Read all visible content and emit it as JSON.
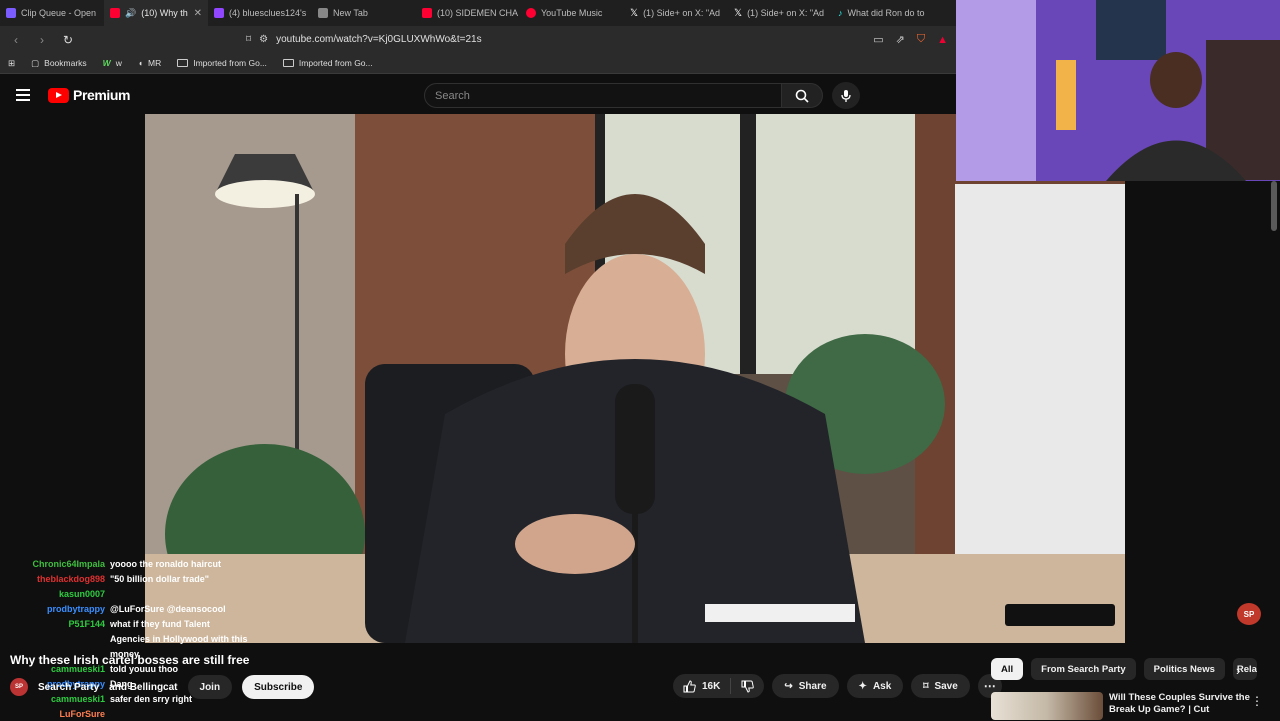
{
  "browser": {
    "tabs": [
      {
        "title": "Clip Queue - Open",
        "color": "#7b5cff"
      },
      {
        "title": "(10) Why th",
        "color": "#ff0033"
      },
      {
        "title": "(4) bluesclues124's",
        "color": "#9146ff"
      },
      {
        "title": "New Tab",
        "color": "#888888"
      },
      {
        "title": "(10) SIDEMEN CHA",
        "color": "#ff0033"
      },
      {
        "title": "YouTube Music",
        "color": "#ff0033"
      },
      {
        "title": "(1) Side+ on X: \"Ad",
        "color": "#ffffff"
      },
      {
        "title": "(1) Side+ on X: \"Ad",
        "color": "#ffffff"
      },
      {
        "title": "What did Ron do to",
        "color": "#25f4ee"
      }
    ],
    "url": "youtube.com/watch?v=Kj0GLUXWhWo&t=21s",
    "bookmarks": [
      {
        "label": "Bookmarks",
        "icon": "bookmarks-icon"
      },
      {
        "label": "w",
        "icon": "w-icon"
      },
      {
        "label": "MR",
        "icon": "mr-icon"
      },
      {
        "label": "Imported from Go...",
        "icon": "folder-icon"
      },
      {
        "label": "Imported from Go...",
        "icon": "folder-icon"
      }
    ]
  },
  "youtube": {
    "logo_text": "Premium",
    "search_placeholder": "Search",
    "video_title": "Why these Irish cartel bosses are still free",
    "channel": "Search Party",
    "channel_extra": "and Bellingcat",
    "avatar_text": "SP",
    "join_label": "Join",
    "subscribe_label": "Subscribe",
    "likes": "16K",
    "share_label": "Share",
    "ask_label": "Ask",
    "save_label": "Save",
    "chips": [
      "All",
      "From Search Party",
      "Politics News",
      "Rela"
    ],
    "related": {
      "title": "Will These Couples Survive the Break Up Game? | Cut"
    },
    "badge": "SP"
  },
  "chat": [
    {
      "user": "Chronic64Impala",
      "color": "#3fbf3f",
      "message": "yoooo the ronaldo haircut"
    },
    {
      "user": "theblackdog898",
      "color": "#e03030",
      "message": "\"50 billion dollar trade\""
    },
    {
      "user": "kasun0007",
      "color": "#2ecc40",
      "message": ""
    },
    {
      "user": "prodbytrappy",
      "color": "#3a8eff",
      "message": "@LuForSure @deansocool"
    },
    {
      "user": "P51F144",
      "color": "#2ecc40",
      "message": "what if they fund Talent"
    },
    {
      "user": "",
      "color": "#ffffff",
      "message": "Agencies in Hollywood with this"
    },
    {
      "user": "",
      "color": "#ffffff",
      "message": "money"
    },
    {
      "user": "cammueski1",
      "color": "#2ecc40",
      "message": "told youuu thoo"
    },
    {
      "user": "prodbytrappy",
      "color": "#3a8eff",
      "message": "Dang"
    },
    {
      "user": "cammueski1",
      "color": "#2ecc40",
      "message": "safer den srry right"
    },
    {
      "user": "LuForSure",
      "color": "#ff7f50",
      "message": ""
    }
  ]
}
